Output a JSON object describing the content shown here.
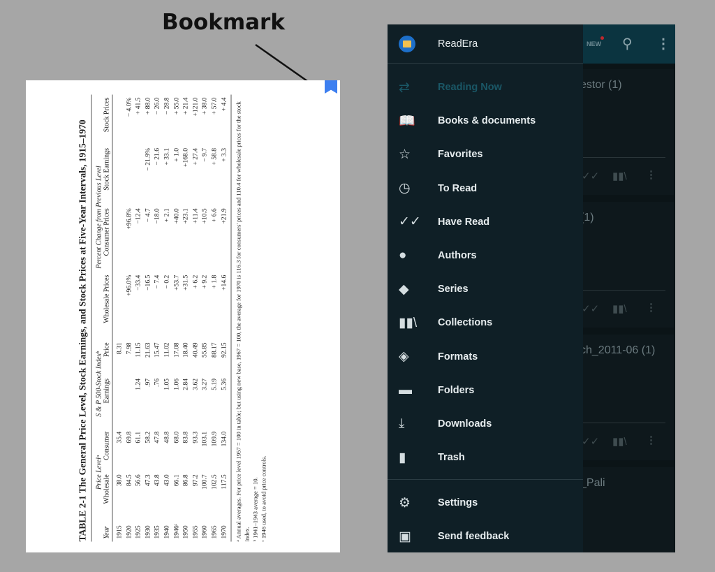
{
  "annotation": {
    "caption": "Bookmark"
  },
  "colors": {
    "background": "#a6a6a6",
    "bookmark": "#3d7ff0",
    "drawer": "#0f1f26",
    "appbar": "#0b3440",
    "active_item": "#1a5766"
  },
  "document": {
    "title": "TABLE 2-1   The General Price Level, Stock Earnings, and Stock Prices at Five-Year Intervals, 1915–1970",
    "group_headers": {
      "price_level": "Price Levelᵃ",
      "sp500": "S & P 500-Stock Indexᵇ",
      "percent_change": "Percent Change from Previous Level"
    },
    "columns": [
      "Year",
      "Wholesale",
      "Consumer",
      "Earnings",
      "Price",
      "Wholesale Prices",
      "Consumer Prices",
      "Stock Earnings",
      "Stock Prices"
    ],
    "rows": [
      [
        "1915",
        "38.0",
        "35.4",
        "",
        "8.31",
        "",
        "",
        "",
        ""
      ],
      [
        "1920",
        "84.5",
        "69.8",
        "",
        "7.98",
        "+96.0%",
        "+96.8%",
        "",
        "− 4.0%"
      ],
      [
        "1925",
        "56.6",
        "61.1",
        "1.24",
        "11.15",
        "−33.4",
        "−12.4",
        "",
        "+ 41.5"
      ],
      [
        "1930",
        "47.3",
        "58.2",
        ".97",
        "21.63",
        "−16.5",
        "− 4.7",
        "− 21.9%",
        "+ 88.0"
      ],
      [
        "1935",
        "43.8",
        "47.8",
        ".76",
        "15.47",
        "− 7.4",
        "−18.0",
        "− 21.6",
        "− 26.0"
      ],
      [
        "1940",
        "43.0",
        "48.8",
        "1.05",
        "11.02",
        "− 0.2",
        "+ 2.1",
        "+ 33.1",
        "− 28.8"
      ],
      [
        "1946ᶜ",
        "66.1",
        "68.0",
        "1.06",
        "17.08",
        "+53.7",
        "+40.0",
        "+ 1.0",
        "+ 55.0"
      ],
      [
        "1950",
        "86.8",
        "83.8",
        "2.84",
        "18.40",
        "+31.5",
        "+23.1",
        "+168.0",
        "+ 21.4"
      ],
      [
        "1955",
        "97.2",
        "93.3",
        "3.62",
        "40.49",
        "+ 6.2",
        "+11.4",
        "+ 27.4",
        "+121.0"
      ],
      [
        "1960",
        "100.7",
        "103.1",
        "3.27",
        "55.85",
        "+ 9.2",
        "+10.5",
        "− 9.7",
        "+ 38.0"
      ],
      [
        "1965",
        "102.5",
        "109.9",
        "5.19",
        "88.17",
        "+ 1.8",
        "+ 6.6",
        "+ 58.8",
        "+ 57.0"
      ],
      [
        "1970",
        "117.5",
        "134.0",
        "5.36",
        "92.15",
        "+14.6",
        "+21.9",
        "+ 3.3",
        "+ 4.4"
      ]
    ],
    "footnotes": [
      "ᵃ Annual averages. For price level 1957 = 100 in table; but using new base, 1967 = 100, the average for 1970 is 116.3 for consumers' prices and 110.4 for wholesale prices for the stock index.",
      "ᵇ 1941–1943 average = 10.",
      "ᶜ 1946 used, to avoid price controls."
    ]
  },
  "appbar": {
    "new_label": "NEW",
    "search_icon": "search-icon",
    "more_icon": "more-vert-icon"
  },
  "cards": [
    {
      "title": "estor (1)"
    },
    {
      "title": "(1)"
    },
    {
      "title": "ch_2011-06 (1)"
    },
    {
      "title": "_Pali"
    }
  ],
  "drawer": {
    "app_name": "ReadEra",
    "items": [
      {
        "label": "Reading Now",
        "icon": "repeat-icon",
        "active": true
      },
      {
        "label": "Books & documents",
        "icon": "book-icon"
      },
      {
        "label": "Favorites",
        "icon": "star-icon"
      },
      {
        "label": "To Read",
        "icon": "clock-icon"
      },
      {
        "label": "Have Read",
        "icon": "double-check-icon"
      },
      {
        "label": "Authors",
        "icon": "person-icon"
      },
      {
        "label": "Series",
        "icon": "tag-icon"
      },
      {
        "label": "Collections",
        "icon": "library-icon"
      },
      {
        "label": "Formats",
        "icon": "layers-icon"
      },
      {
        "label": "Folders",
        "icon": "folder-icon"
      },
      {
        "label": "Downloads",
        "icon": "download-icon"
      },
      {
        "label": "Trash",
        "icon": "trash-icon"
      }
    ],
    "footer_items": [
      {
        "label": "Settings",
        "icon": "gear-icon"
      },
      {
        "label": "Send feedback",
        "icon": "feedback-icon"
      }
    ]
  }
}
